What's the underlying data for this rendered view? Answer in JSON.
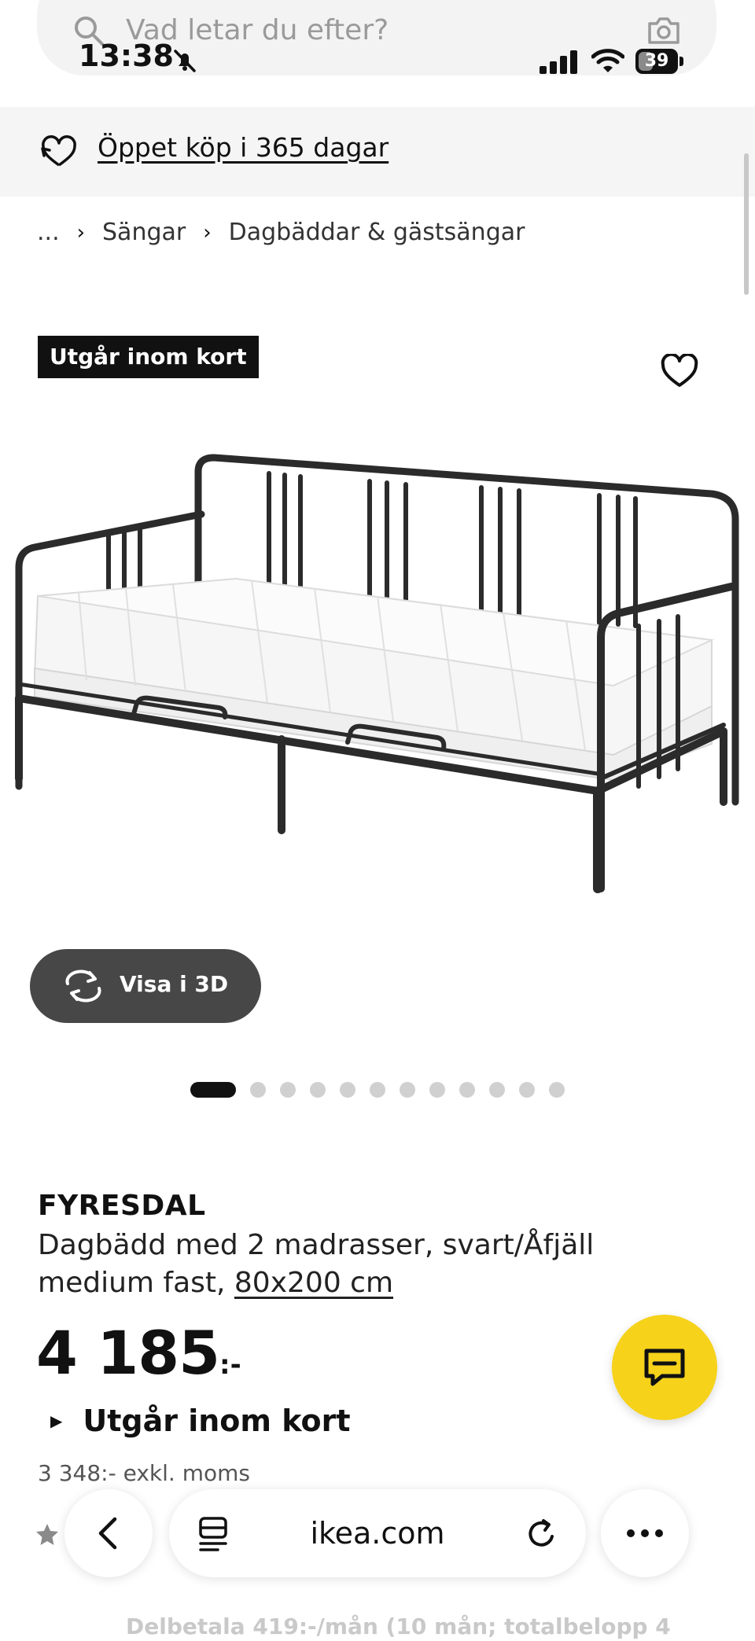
{
  "search": {
    "placeholder": "Vad letar du efter?"
  },
  "status_bar": {
    "time": "13:38",
    "battery": "39",
    "battery_level": 0.39
  },
  "promo": {
    "text": "Öppet köp i 365 dagar"
  },
  "breadcrumb": {
    "items": [
      "...",
      "Sängar",
      "Dagbäddar & gästsängar"
    ]
  },
  "product": {
    "tag": "Utgår inom kort",
    "view_3d": "Visa i 3D",
    "carousel": {
      "total": 12,
      "active_index": 0
    },
    "name": "FYRESDAL",
    "description": "Dagbädd med 2 madrasser, svart/Åfjäll medium fast, ",
    "size": "80x200 cm",
    "price_main": "4 185",
    "price_suffix": ":-",
    "availability": "Utgår inom kort",
    "price_ex_vat": "3 348:- exkl. moms",
    "installment": "Delbetala 419:-/mån (10 mån; totalbelopp 4"
  },
  "browser": {
    "url": "ikea.com"
  },
  "colors": {
    "chat_fab": "#f6d21a",
    "tag_bg": "#111111",
    "view3d_bg": "#474747"
  },
  "icons": [
    "search-icon",
    "camera-icon",
    "mute-icon",
    "signal-icon",
    "wifi-icon",
    "battery-icon",
    "return-icon",
    "heart-icon",
    "rotate-3d-icon",
    "chat-icon",
    "star-icon",
    "back-icon",
    "reader-icon",
    "reload-icon",
    "more-icon"
  ]
}
